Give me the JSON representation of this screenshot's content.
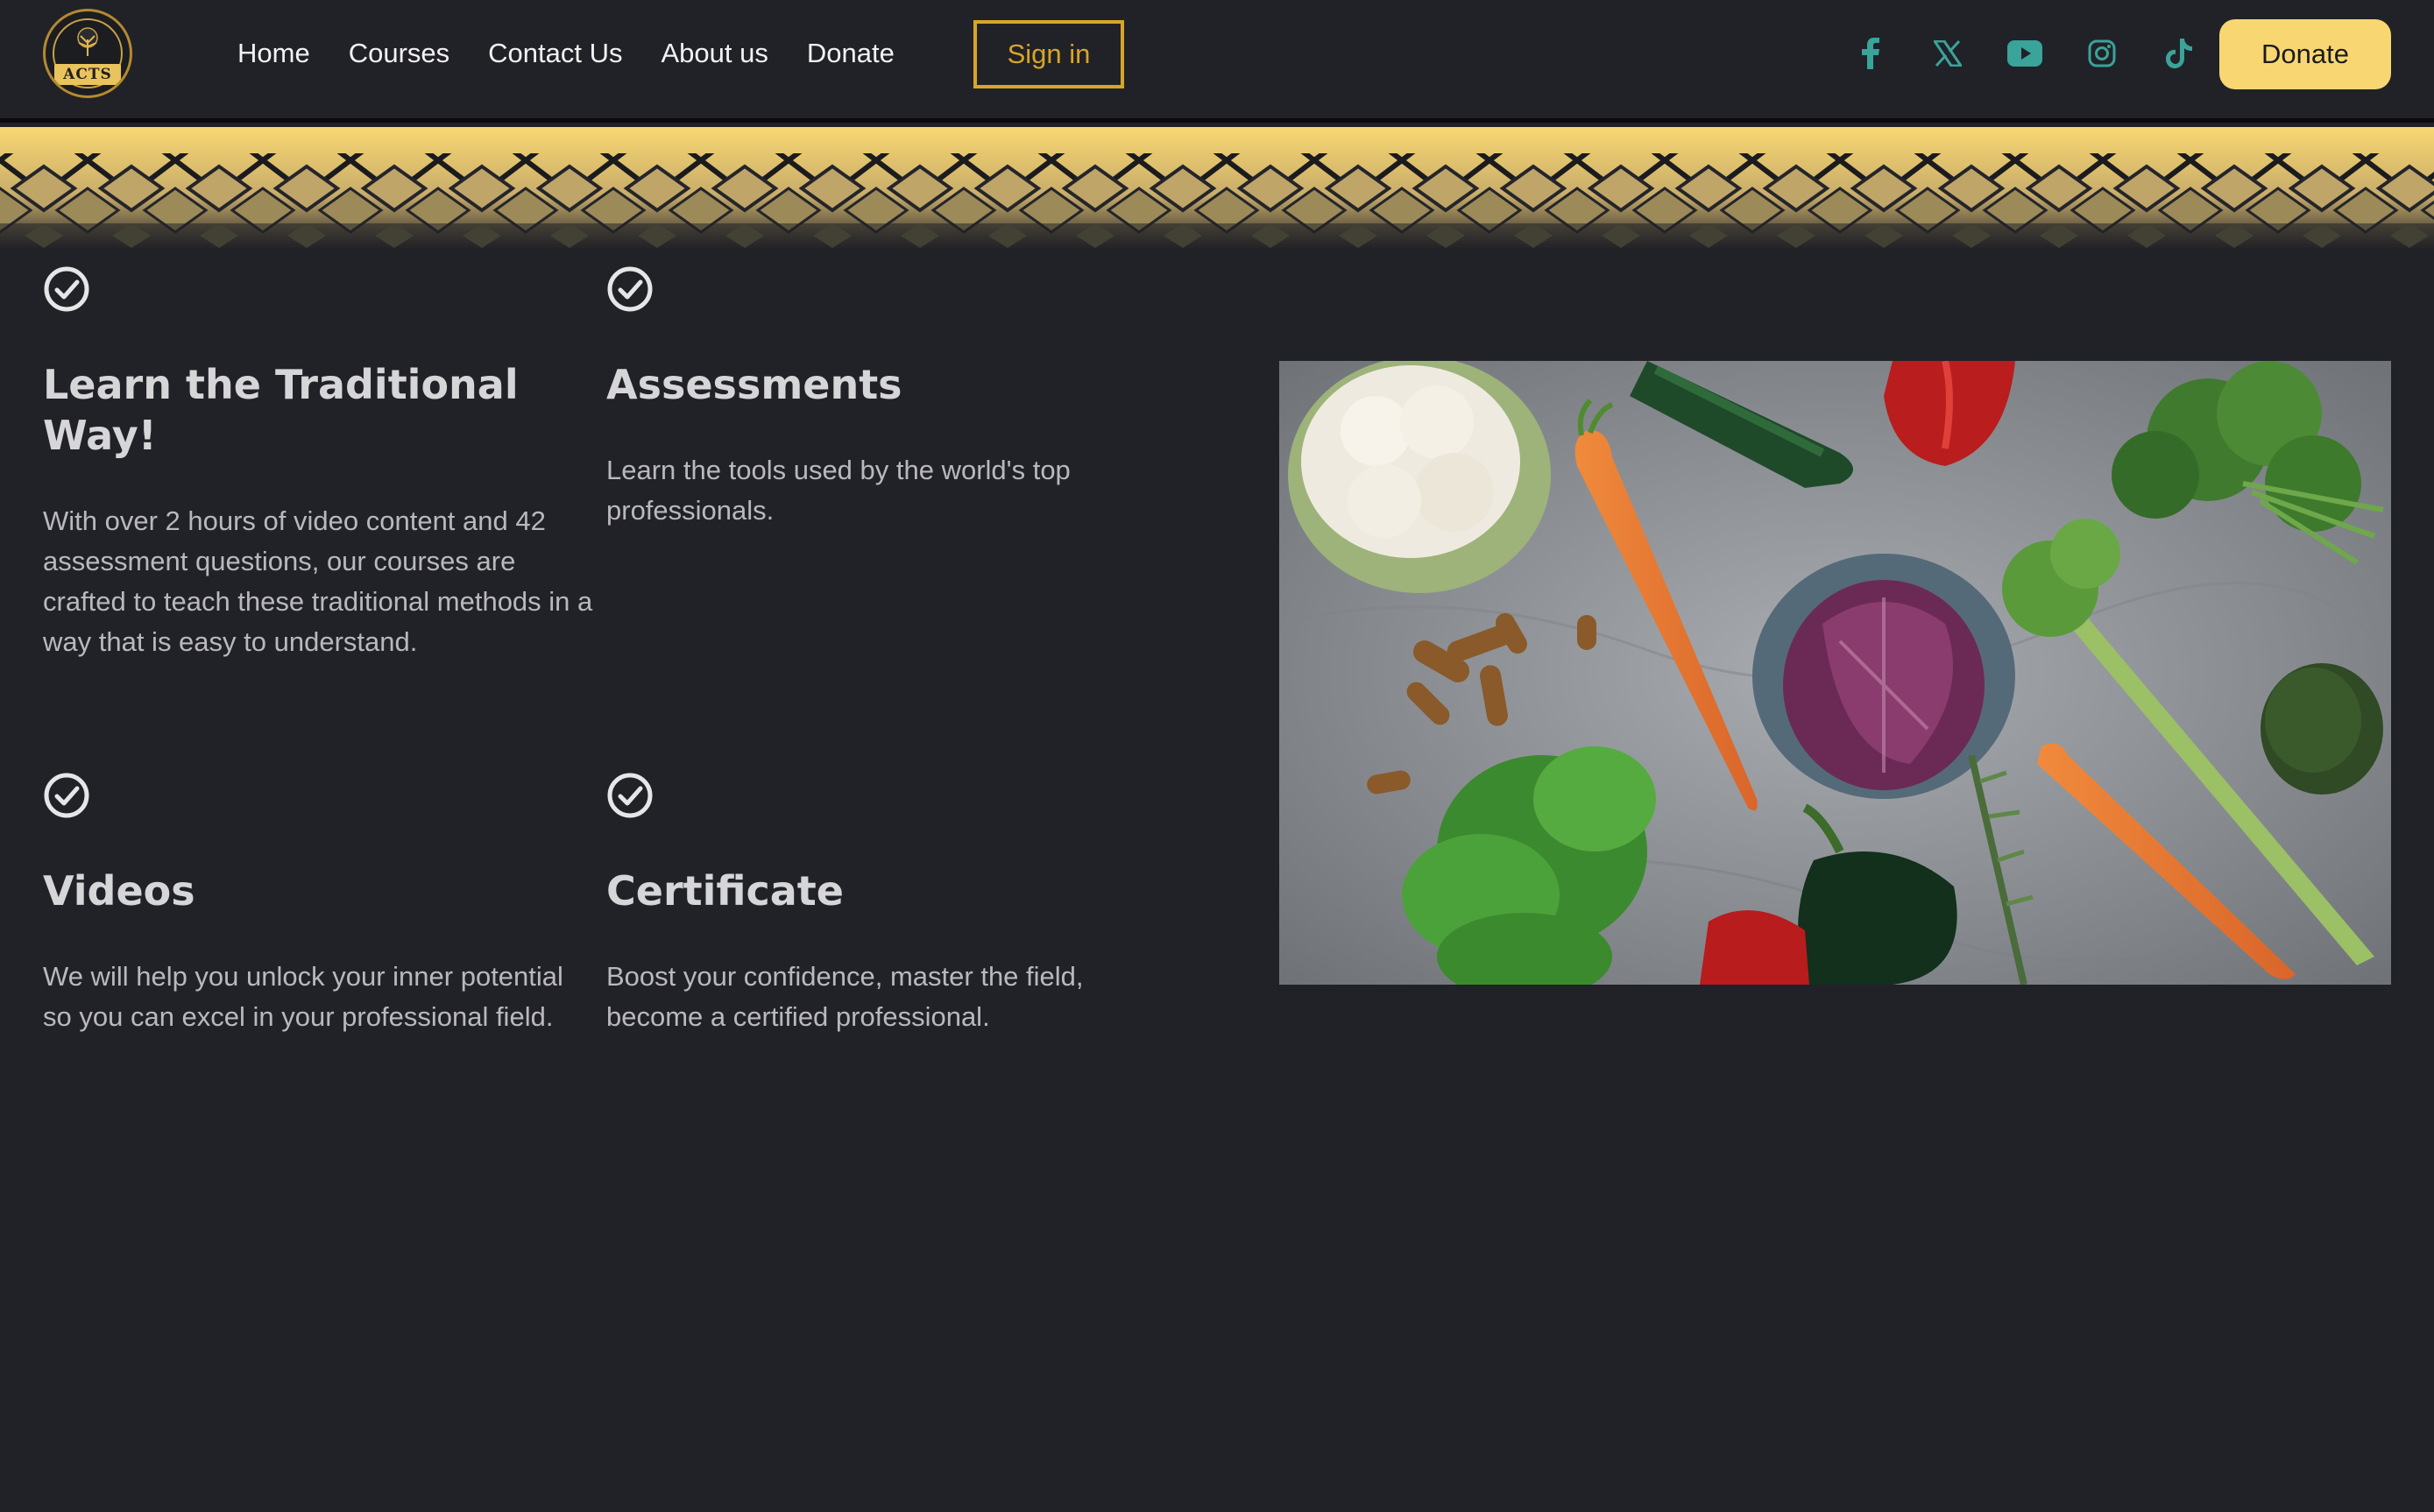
{
  "brand": {
    "logo_text": "ACTS"
  },
  "nav": {
    "items": [
      "Home",
      "Courses",
      "Contact Us",
      "About us",
      "Donate"
    ],
    "signin_label": "Sign in",
    "donate_label": "Donate"
  },
  "social_icons": [
    "facebook-icon",
    "x-icon",
    "youtube-icon",
    "instagram-icon",
    "tiktok-icon"
  ],
  "colors": {
    "accent": "#f8d772",
    "signin": "#d7a52a",
    "social": "#3aa39a",
    "background": "#212227"
  },
  "features": [
    {
      "title": "Learn the Traditional Way!",
      "text": "With over 2 hours of video content and 42 assessment questions, our courses are crafted to teach these traditional methods in a way that is easy to understand."
    },
    {
      "title": "Assessments",
      "text": "Learn the tools used by the world's top professionals."
    },
    {
      "title": "Videos",
      "text": "We will help you unlock your inner potential so you can excel in your professional field."
    },
    {
      "title": "Certificate",
      "text": "Boost your confidence, master the field, become a certified professional."
    }
  ]
}
